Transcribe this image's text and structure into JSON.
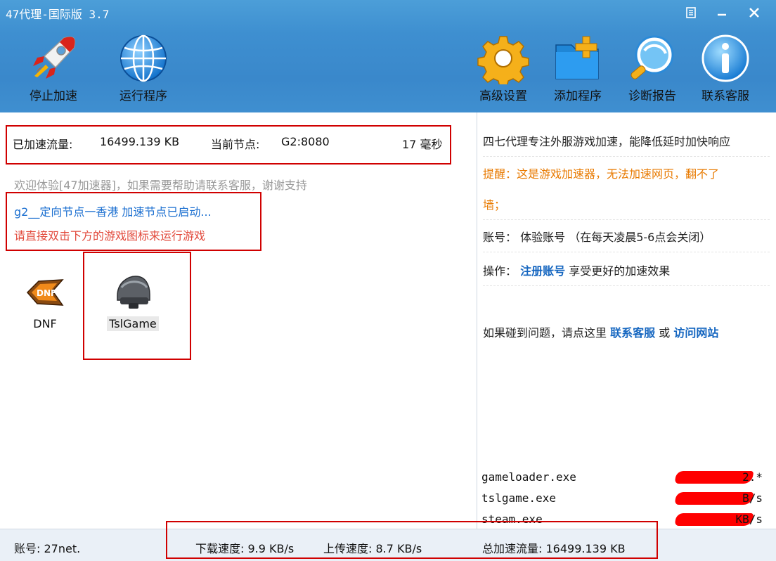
{
  "window": {
    "title": "47代理-国际版 3.7"
  },
  "toolbar": {
    "left": [
      {
        "label": "停止加速",
        "icon": "rocket-icon"
      },
      {
        "label": "运行程序",
        "icon": "globe-icon"
      }
    ],
    "right": [
      {
        "label": "高级设置",
        "icon": "gear-icon"
      },
      {
        "label": "添加程序",
        "icon": "add-folder-icon"
      },
      {
        "label": "诊断报告",
        "icon": "magnifier-icon"
      },
      {
        "label": "联系客服",
        "icon": "info-icon"
      }
    ]
  },
  "main": {
    "traffic_label": "已加速流量:",
    "traffic_value": "16499.139 KB",
    "node_label": "当前节点:",
    "node_value": "G2:8080",
    "latency": "17 毫秒",
    "welcome": "欢迎体验[47加速器]，如果需要帮助请联系客服，谢谢支持",
    "status_line1": "g2__定向节点一香港 加速节点已启动...",
    "status_line2": "请直接双击下方的游戏图标来运行游戏",
    "games": [
      {
        "label": "DNF"
      },
      {
        "label": "TslGame"
      }
    ]
  },
  "side": {
    "intro": "四七代理专注外服游戏加速，能降低延时加快响应",
    "reminder_line1": "提醒：这是游戏加速器，无法加速网页，翻不了",
    "reminder_line2": "墙；",
    "account_label": "账号：",
    "account_value": "体验账号 （在每天凌晨5-6点会关闭）",
    "op_label": "操作：",
    "register_link": "注册账号",
    "op_suffix": "享受更好的加速效果",
    "help_text": "如果碰到问题，请点这里",
    "contact_link": "联系客服",
    "or_text": "或",
    "visit_link": "访问网站",
    "processes": [
      {
        "name": "gameloader.exe",
        "value": "2.*"
      },
      {
        "name": "tslgame.exe",
        "value": "B/s"
      },
      {
        "name": "steam.exe",
        "value": "KB/s"
      }
    ]
  },
  "statusbar": {
    "account": "账号: 27net.",
    "download": "下载速度: 9.9 KB/s",
    "upload": "上传速度: 8.7 KB/s",
    "total": "总加速流量: 16499.139 KB"
  }
}
